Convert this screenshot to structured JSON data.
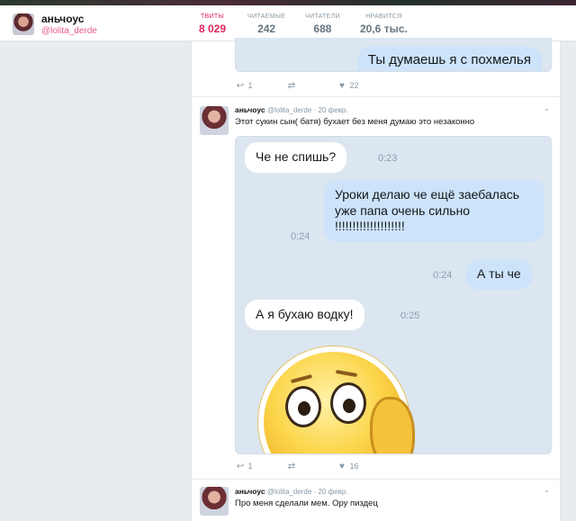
{
  "profile": {
    "name": "аньчоус",
    "handle": "@lolita_derde",
    "stats": [
      {
        "label": "ТВИТЫ",
        "value": "8 029"
      },
      {
        "label": "ЧИТАЕМЫЕ",
        "value": "242"
      },
      {
        "label": "ЧИТАТЕЛИ",
        "value": "688"
      },
      {
        "label": "НРАВИТСЯ",
        "value": "20,6 тыс."
      }
    ]
  },
  "tweet0": {
    "bubble": "Ты думаешь я с похмелья",
    "replies": "1",
    "likes": "22"
  },
  "tweet1": {
    "name": "аньчоус",
    "handle": "@lolita_derde",
    "date": "· 20 февр.",
    "text": "Этот сукин сын( батя) бухает без меня думаю это незаконно",
    "chat": {
      "b1": "Че не спишь?",
      "t1": "0:23",
      "b2": "Уроки делаю че ещё заебалась уже папа очень сильно !!!!!!!!!!!!!!!!!!!!",
      "t2": "0:24",
      "b3": "А ты че",
      "t3": "0:24",
      "b4": "А я бухаю водку!",
      "t4": "0:25"
    },
    "replies": "1",
    "likes": "16"
  },
  "tweet2": {
    "name": "аньчоус",
    "handle": "@lolita_derde",
    "date": "· 20 февр.",
    "text": "Про меня сделали мем. Ору пиздец"
  },
  "icons": {
    "reply": "reply-icon",
    "retweet": "retweet-icon",
    "like": "heart-icon",
    "caret": "chevron-down-icon"
  },
  "colors": {
    "accent": "#e0245e",
    "bubble_out": "#cde3fa",
    "chat_bg": "#dbe6f0"
  }
}
